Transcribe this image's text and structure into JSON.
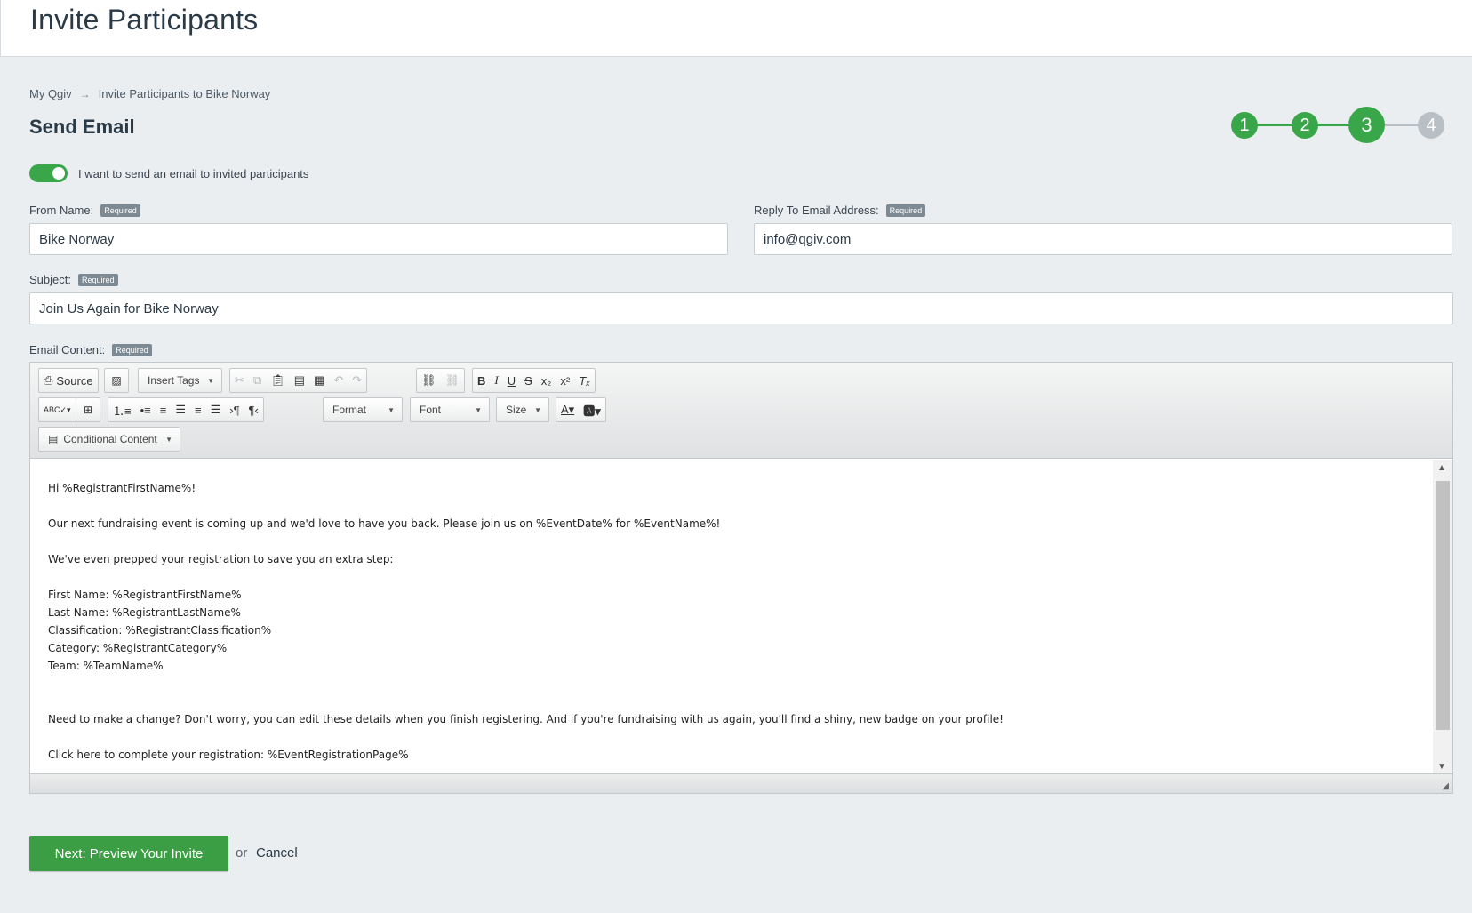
{
  "header": {
    "title": "Invite Participants"
  },
  "breadcrumb": {
    "home": "My Qgiv",
    "arrow": "→",
    "current": "Invite Participants to Bike Norway"
  },
  "section_title": "Send Email",
  "stepper": {
    "steps": [
      "1",
      "2",
      "3",
      "4"
    ],
    "current": 3,
    "complete_color": "#3aa64a",
    "pending_color": "#b9c0c5"
  },
  "toggle": {
    "on": true,
    "label": "I want to send an email to invited participants"
  },
  "form": {
    "required_badge": "Required",
    "from_name": {
      "label": "From Name:",
      "value": "Bike Norway"
    },
    "reply_to": {
      "label": "Reply To Email Address:",
      "value": "info@qgiv.com"
    },
    "subject": {
      "label": "Subject:",
      "value": "Join Us Again for Bike Norway"
    },
    "email_content": {
      "label": "Email Content:"
    }
  },
  "toolbar": {
    "source": "Source",
    "insert_tags": "Insert Tags",
    "format": "Format",
    "font": "Font",
    "size": "Size",
    "conditional": "Conditional Content",
    "icons": {
      "image": "image-icon",
      "cut": "cut-icon",
      "copy": "copy-icon",
      "paste": "paste-icon",
      "paste_text": "paste-text-icon",
      "paste_word": "paste-word-icon",
      "undo": "undo-icon",
      "redo": "redo-icon",
      "link": "link-icon",
      "unlink": "unlink-icon",
      "bold": "bold-icon",
      "italic": "italic-icon",
      "underline": "underline-icon",
      "strike": "strikethrough-icon",
      "subscript": "subscript-icon",
      "superscript": "superscript-icon",
      "remove_format": "remove-format-icon",
      "spellcheck": "spellcheck-icon",
      "table": "table-icon",
      "numbered_list": "numbered-list-icon",
      "bulleted_list": "bulleted-list-icon",
      "align_left": "align-left-icon",
      "align_center": "align-center-icon",
      "align_right": "align-right-icon",
      "justify": "justify-icon",
      "ltr": "ltr-icon",
      "rtl": "rtl-icon",
      "text_color": "text-color-icon",
      "bg_color": "background-color-icon"
    }
  },
  "body": {
    "greeting": "Hi %RegistrantFirstName%!",
    "p1": "Our next fundraising event is coming up and we'd love to have you back. Please join us on %EventDate% for %EventName%!",
    "p2": "We've even prepped your registration to save you an extra step:",
    "details": [
      "First Name: %RegistrantFirstName%",
      "Last Name: %RegistrantLastName%",
      "Classification: %RegistrantClassification%",
      "Category: %RegistrantCategory%",
      "Team: %TeamName%"
    ],
    "p3": "Need to make a change? Don't worry, you can edit these details when you finish registering. And if you're fundraising with us again, you'll find a shiny, new badge on your profile!",
    "p4": "Click here to complete your registration: %EventRegistrationPage%"
  },
  "actions": {
    "next": "Next: Preview Your Invite",
    "or": "or",
    "cancel": "Cancel"
  }
}
